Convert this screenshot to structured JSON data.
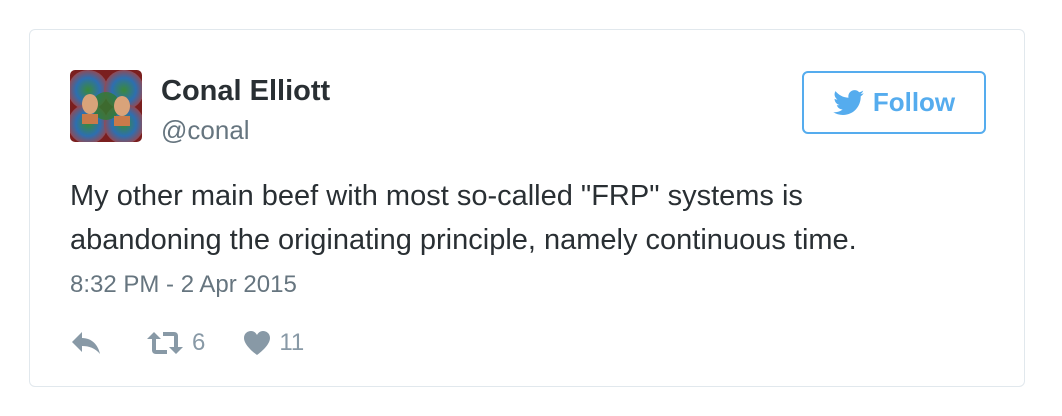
{
  "user": {
    "display_name": "Conal Elliott",
    "handle": "@conal",
    "avatar_icon": "profile-photo"
  },
  "follow_button": {
    "label": "Follow",
    "icon": "twitter-bird-icon",
    "color": "#55acee"
  },
  "tweet": {
    "lines": [
      "My other main beef with most so-called \"FRP\" systems is",
      "abandoning the originating principle, namely continuous time."
    ],
    "timestamp": "8:32 PM - 2 Apr 2015"
  },
  "actions": {
    "reply_icon": "reply-icon",
    "retweet_icon": "retweet-icon",
    "retweet_count": "6",
    "like_icon": "heart-icon",
    "like_count": "11"
  },
  "colors": {
    "text": "#292f33",
    "secondary": "#66757f",
    "action": "#8899a6",
    "border": "#e1e8ed"
  }
}
